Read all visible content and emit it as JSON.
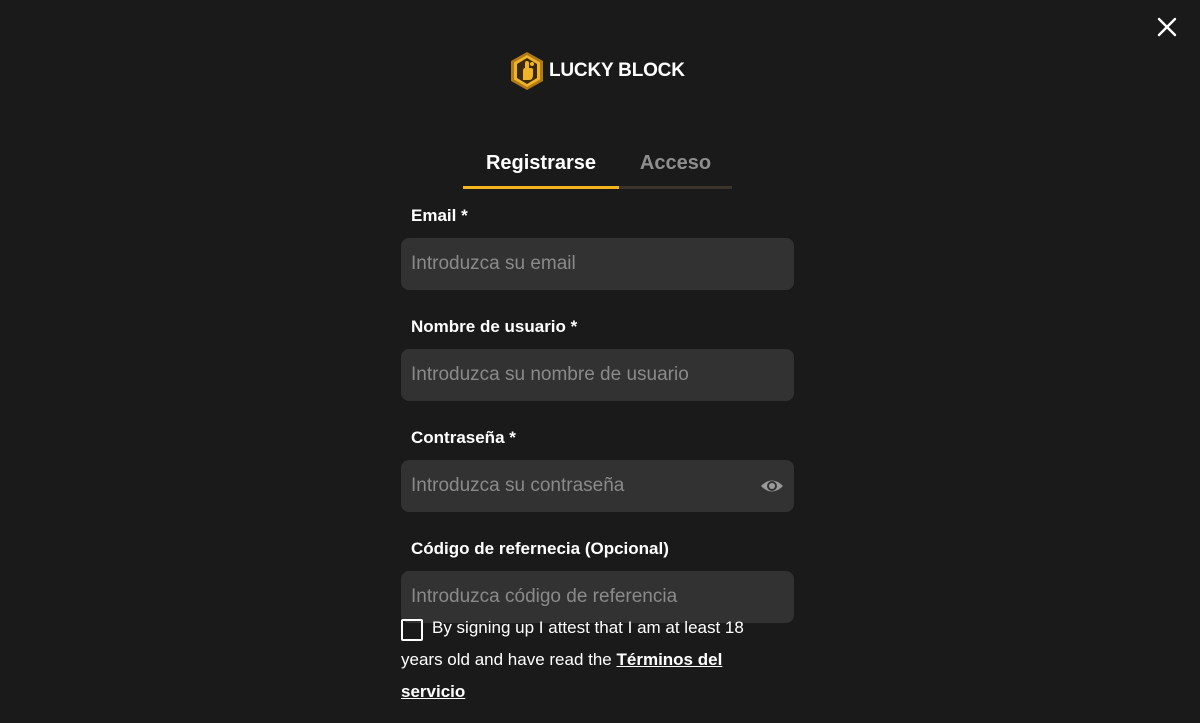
{
  "close": {
    "icon": "close-icon"
  },
  "logo": {
    "text": "LUCKY BLOCK",
    "icon": "lucky-block-hex-icon"
  },
  "tabs": [
    {
      "label": "Registrarse",
      "active": true
    },
    {
      "label": "Acceso",
      "active": false
    }
  ],
  "form": {
    "email": {
      "label": "Email *",
      "placeholder": "Introduzca su email",
      "value": ""
    },
    "username": {
      "label": "Nombre de usuario *",
      "placeholder": "Introduzca su nombre de usuario",
      "value": ""
    },
    "password": {
      "label": "Contraseña *",
      "placeholder": "Introduzca su contraseña",
      "value": "",
      "toggle_icon": "eye-icon"
    },
    "referral": {
      "label": "Código de refernecia (Opcional)",
      "placeholder": "Introduzca código de referencia",
      "value": ""
    }
  },
  "terms": {
    "checked": false,
    "text_before": "By signing up I attest that I am at least 18 years old and have read the",
    "link_text": "Términos del servicio"
  },
  "colors": {
    "background": "#1a1a1a",
    "input_bg": "#323232",
    "accent": "#f4b41e",
    "muted": "#8e8e8e"
  }
}
